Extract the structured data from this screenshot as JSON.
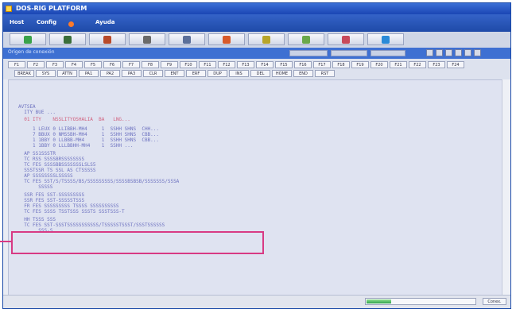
{
  "window": {
    "title": "DOS-RIG PLATFORM"
  },
  "menu": {
    "items": [
      "Host",
      "Config",
      "Ayuda"
    ]
  },
  "toolbar": {
    "buttons": [
      {
        "icon": "green-square-icon",
        "color": "#3aa24a"
      },
      {
        "icon": "puzzle-icon",
        "color": "#3a6e3a"
      },
      {
        "icon": "person-icon",
        "color": "#b84a2a"
      },
      {
        "icon": "tools-icon",
        "color": "#6a6a6a"
      },
      {
        "icon": "printer-icon",
        "color": "#5b6f9a"
      },
      {
        "icon": "document-icon",
        "color": "#d85a2a"
      },
      {
        "icon": "pencil-icon",
        "color": "#b8a52a"
      },
      {
        "icon": "chart-icon",
        "color": "#6aa84a"
      },
      {
        "icon": "clipboard-icon",
        "color": "#c84a5a"
      },
      {
        "icon": "globe-icon",
        "color": "#2a8ad8"
      }
    ]
  },
  "subbar": {
    "label": "Origen de conexión"
  },
  "function_keys": {
    "row1": [
      "F1",
      "F2",
      "F3",
      "F4",
      "F5",
      "F6",
      "F7",
      "F8",
      "F9",
      "F10",
      "F11",
      "F12",
      "F13",
      "F14",
      "F15",
      "F16",
      "F17",
      "F18",
      "F19",
      "F20",
      "F21",
      "F22",
      "F23",
      "F24"
    ],
    "row2": [
      "BREAK",
      "SYS",
      "ATTN",
      "PA1",
      "PA2",
      "PA3",
      "CLR",
      "ENT",
      "ERF",
      "DUP",
      "INS",
      "DEL",
      "HOME",
      "END",
      "RST"
    ]
  },
  "terminal_lines": [
    {
      "text": "AVTSEA",
      "red": false
    },
    {
      "text": "  ITY BUE ...",
      "red": false
    },
    {
      "text": "  01 ITY    NSSLITYOSHALIA  BA   LNG...",
      "red": true
    },
    {
      "text": "     1 LEUX 0 LLIBBH-MH4     1  SSHH SHNS  CHH...",
      "red": false
    },
    {
      "text": "     7 BBUX 0 NMSSBH-MH4     1  SSHH SHNS  CBB...",
      "red": false
    },
    {
      "text": "     1 1BBY 0 LLBBB-MH4      1  SSHH SHNS  CBB...",
      "red": false
    },
    {
      "text": "     1 1BBY 0 LLLBBHH-MH4    1  SSHH ...",
      "red": false
    },
    {
      "text": "  AP SS1SSSTR",
      "red": false
    },
    {
      "text": "  TC RSS SSSSBRSSSSSSSS",
      "red": false
    },
    {
      "text": "  TC FES SSSSBBSSSSSSSLSLS5",
      "red": false
    },
    {
      "text": "  SSSTSSR TS SSL AS CTSSSSS",
      "red": false
    },
    {
      "text": "  AP SSSSSSSSLSSSSS",
      "red": false
    },
    {
      "text": "  TC FES SST/S/TSSSS/BS/SSSSSSSSS/SSSSBSBSB/SSSSSSS/SSSA",
      "red": false
    },
    {
      "text": "       SSSSS",
      "red": false
    },
    {
      "text": "  SSR FES SST-SSSSSSSSS",
      "red": false
    },
    {
      "text": "  SSR FES SST-SSSSSTSSS",
      "red": false
    },
    {
      "text": "  FR FES SSSSSSSSS TSSSS SSSSSSSSSS",
      "red": false
    },
    {
      "text": "  TC FES SSSS TSSTSSS SSSTS SSSTSSS-T",
      "red": false
    },
    {
      "text": "  HH TSSS SSS",
      "red": false
    },
    {
      "text": "  TC FES SST-SSSTSSSSSSSSSSS/TSSSSSTSSST/SSSTSSSSSS",
      "red": false
    },
    {
      "text": "       SSS-S",
      "red": false
    }
  ],
  "status": {
    "progress_fraction": 0.23,
    "button_label": "Conex."
  }
}
